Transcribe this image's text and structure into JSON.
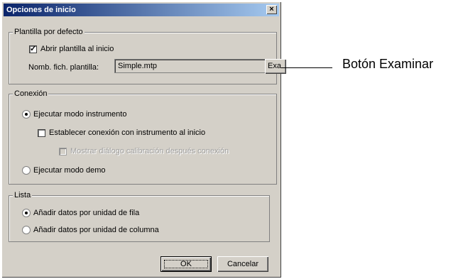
{
  "dialog": {
    "title": "Opciones de inicio",
    "close_glyph": "×"
  },
  "plantilla": {
    "legend": "Plantilla por defecto",
    "open_template_label": "Abrir plantilla al inicio",
    "open_template_checked": true,
    "file_label": "Nomb. fich. plantilla:",
    "file_value": "Simple.mtp",
    "browse_label": "Exa"
  },
  "conexion": {
    "legend": "Conexión",
    "instrument_mode_label": "Ejecutar modo instrumento",
    "connect_label": "Establecer conexión con instrumento al inicio",
    "calibration_label": "Mostrar diálogo calibración después conexión",
    "demo_mode_label": "Ejecutar modo demo"
  },
  "lista": {
    "legend": "Lista",
    "by_row_label": "Añadir datos por unidad de fila",
    "by_column_label": "Añadir datos por unidad de columna"
  },
  "buttons": {
    "ok_label": "OK",
    "cancel_label": "Cancelar"
  },
  "annotation": {
    "text": "Botón Examinar"
  },
  "colors": {
    "dialog_bg": "#d4d0c8",
    "titlebar_start": "#0a246a",
    "titlebar_end": "#a6caf0"
  }
}
